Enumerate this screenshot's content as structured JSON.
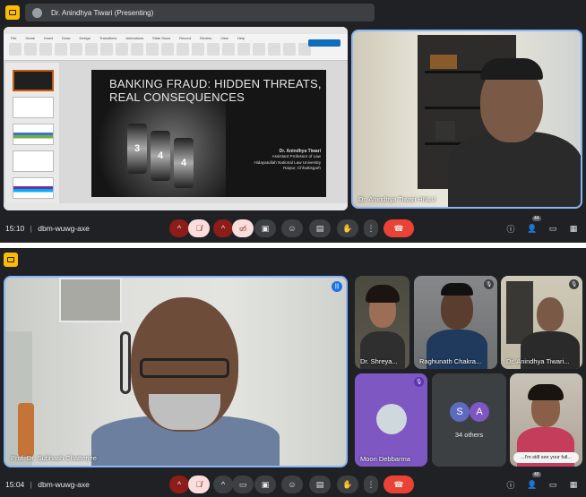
{
  "top": {
    "presenting_text": "Dr. Anindhya Tiwari (Presenting)",
    "slide": {
      "title_line1": "BANKING FRAUD: HIDDEN THREATS,",
      "title_line2": "REAL CONSEQUENCES",
      "author": "Dr. Anindhya Tiwari",
      "role": "Assistant Professor of Law",
      "university": "Hidayatullah National Law University",
      "city": "Raipur, Chhattisgarh"
    },
    "speaker_name": "Dr. Anindhya Tiwari HNLU",
    "clock": "15:10",
    "meeting_code": "dbm-wuwg-axe",
    "people_count": "44"
  },
  "bottom": {
    "main_speaker_name": "Prof. Dr. Subhash Chatterjee",
    "participants": [
      {
        "name": "Dr. Shreya..."
      },
      {
        "name": "Raghunath Chakra..."
      },
      {
        "name": "Dr. Anindhya Tiwari..."
      },
      {
        "name": "Moon Debbarma"
      }
    ],
    "others": {
      "avatar1": "S",
      "avatar2": "A",
      "label": "34 others"
    },
    "caption_chip": "...I'm still see your full...",
    "clock": "15:04",
    "meeting_code": "dbm-wuwg-axe",
    "people_count": "40"
  },
  "icons": {
    "chevron": "^",
    "more": "⋮",
    "info": "ⓘ",
    "people": "👥",
    "chat": "💬",
    "grid": "▦"
  },
  "colors": {
    "end_call": "#ea4335",
    "active_border": "#8ab4f8",
    "badge": "#fbbc04"
  }
}
